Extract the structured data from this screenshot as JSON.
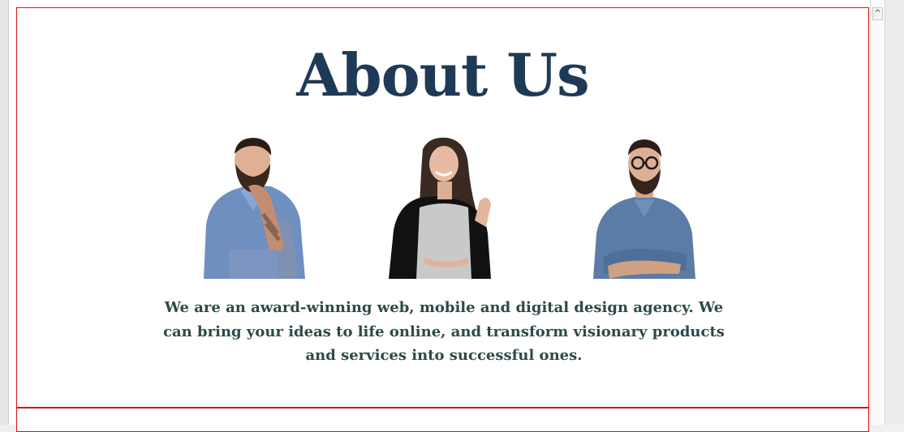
{
  "about": {
    "title": "About Us",
    "description": "We are an award-winning web, mobile and digital design agency. We can bring your ideas to life online, and transform visionary products and services into successful ones."
  },
  "team": [
    {
      "photo": "bearded-man-thinking-photo"
    },
    {
      "photo": "smiling-woman-photo"
    },
    {
      "photo": "man-with-glasses-arms-crossed-photo"
    }
  ],
  "scrollbar": {
    "up_arrow": "^"
  },
  "colors": {
    "title": "#1f3a56",
    "description": "#2c4a4a",
    "section_border": "#d31515"
  }
}
